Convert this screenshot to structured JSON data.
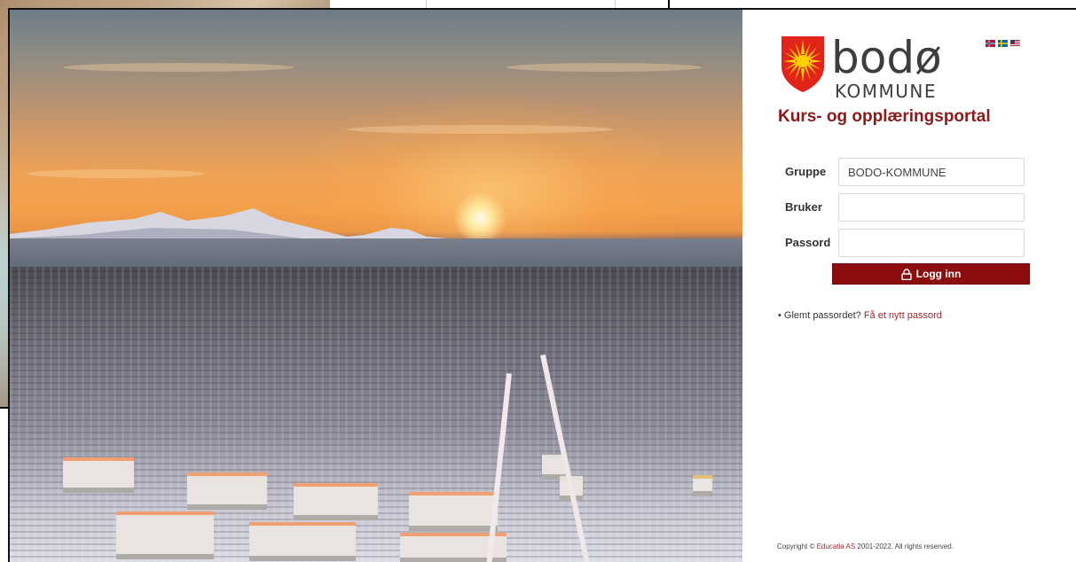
{
  "logo": {
    "brand": "bodø",
    "subtitle": "KOMMUNE"
  },
  "languages": [
    {
      "name": "Norsk",
      "icon": "norway-flag-icon"
    },
    {
      "name": "Svenska",
      "icon": "sweden-flag-icon"
    },
    {
      "name": "English",
      "icon": "usa-flag-icon"
    }
  ],
  "portal_title": "Kurs- og opplæringsportal",
  "form": {
    "group_label": "Gruppe",
    "group_value": "BODO-KOMMUNE",
    "user_label": "Bruker",
    "user_value": "",
    "password_label": "Passord",
    "password_value": "",
    "login_label": "Logg inn"
  },
  "forgot": {
    "text": "Glemt passordet?",
    "link": "Få et nytt passord"
  },
  "copyright": {
    "prefix": "Copyright ©",
    "company": "Educatia AS",
    "suffix": "2001-2022. All rights reserved."
  },
  "colors": {
    "brand_red": "#8b0d0d",
    "title_red": "#8b1a1a",
    "link_red": "#a0272d"
  }
}
